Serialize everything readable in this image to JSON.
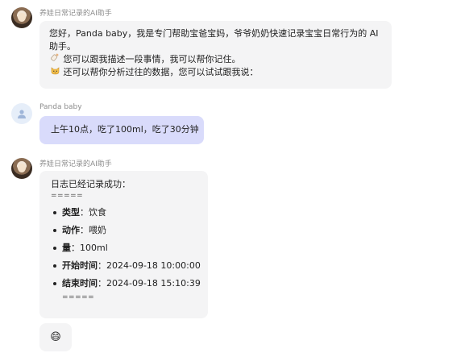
{
  "messages": [
    {
      "role": "assistant",
      "sender": "养娃日常记录的AI助手",
      "lines": [
        "您好，Panda baby，我是专门帮助宝爸宝妈，爷爷奶奶快速记录宝宝日常行为的 AI",
        "助手。",
        "您可以跟我描述一段事情，我可以帮你记住。",
        "还可以帮你分析过往的数据，您可以试试跟我说："
      ],
      "line_icons": [
        "",
        "",
        "baby-bottle-icon",
        "cat-face-icon"
      ]
    },
    {
      "role": "user",
      "sender": "Panda baby",
      "text": "上午10点，吃了100ml，吃了30分钟"
    },
    {
      "role": "assistant",
      "sender": "养娃日常记录的AI助手",
      "heading": "日志已经记录成功：",
      "separator": "=====",
      "fields": [
        {
          "key": "类型",
          "value": "饮食"
        },
        {
          "key": "动作",
          "value": "喂奶"
        },
        {
          "key": "量",
          "value": "100ml"
        },
        {
          "key": "开始时间",
          "value": "2024-09-18 10:00:00"
        },
        {
          "key": "结束时间",
          "value": "2024-09-18 15:10:39"
        }
      ],
      "closing_separator": "====="
    },
    {
      "role": "assistant",
      "emoji": "😄"
    }
  ],
  "colors": {
    "assistant_bubble": "#f4f4f5",
    "user_bubble": "#d9dbfb",
    "sender_text": "#8c8c8c"
  }
}
